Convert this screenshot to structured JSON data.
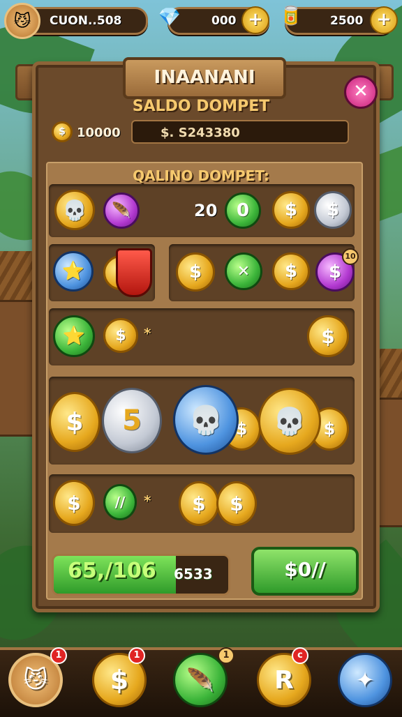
{
  "topbar": {
    "player_name": "CUON..508",
    "gem_value": "000",
    "energy_value": "2500"
  },
  "panel": {
    "title": "INAANANI",
    "subtitle": "SALDO DOMPET",
    "balance_value": "10000",
    "balance_field": "$. S243380",
    "section_title": "QALINO DOMPET:"
  },
  "row1": {
    "count": "20",
    "badge": "10"
  },
  "coins": {
    "dollar": "$",
    "five": "5",
    "r": "R",
    "x": "✕"
  },
  "marks": {
    "asterisk": "*"
  },
  "footer": {
    "big_value": "65,/106",
    "small_value": "6533",
    "confirm_label": "$0//"
  },
  "nav": {
    "badges": [
      "1",
      "1",
      "1",
      "c"
    ]
  },
  "colors": {
    "accent": "#f6c96e",
    "panel": "#6b4a2b",
    "confirm": "#3cb53a",
    "close": "#c71e7a"
  }
}
